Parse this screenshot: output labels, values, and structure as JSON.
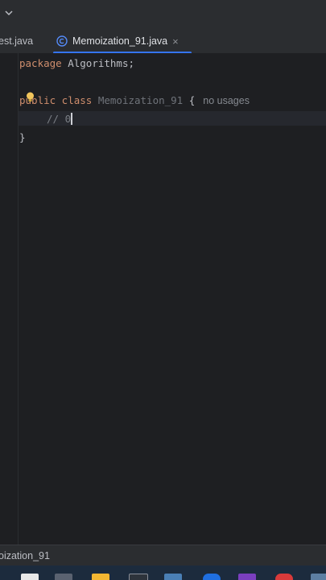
{
  "tabs": {
    "prev_label": "est.java",
    "active_label": "Memoization_91.java",
    "close_glyph": "×",
    "active_icon": "class-c-icon"
  },
  "code": {
    "line1_kw": "package",
    "line1_rest": " Algorithms;",
    "line3_kw": "public class",
    "line3_name": "Memoization_91",
    "line3_brace": "{",
    "line3_hint": "no usages",
    "line4_comment": "// 0",
    "line5_brace": "}"
  },
  "statusbar": {
    "breadcrumb": "oization_91"
  },
  "colors": {
    "keyword": "#cf8e6d",
    "accent": "#3574f0",
    "background": "#1e1f22",
    "panel": "#2b2d30"
  }
}
